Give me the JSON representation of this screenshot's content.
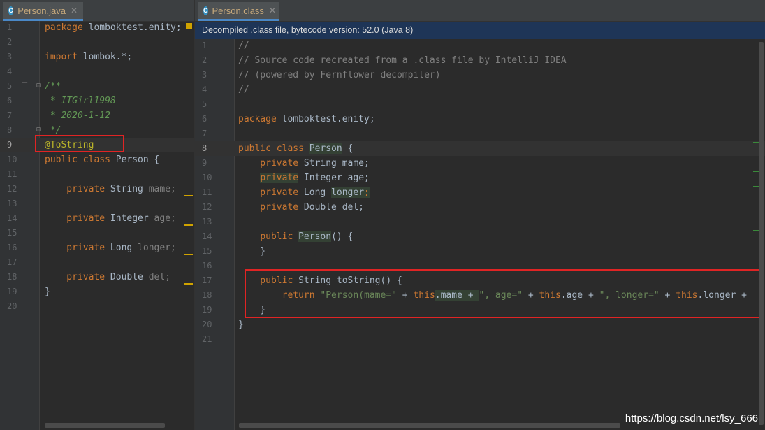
{
  "left_tab": {
    "label": "Person.java",
    "icon": "java-class-icon",
    "close": "✕"
  },
  "right_tab": {
    "label": "Person.class",
    "icon": "java-class-icon",
    "close": "✕"
  },
  "info_bar": "Decompiled .class file, bytecode version: 52.0 (Java 8)",
  "left_numbers": [
    "1",
    "2",
    "3",
    "4",
    "5",
    "6",
    "7",
    "8",
    "9",
    "10",
    "11",
    "12",
    "13",
    "14",
    "15",
    "16",
    "17",
    "18",
    "19",
    "20"
  ],
  "right_numbers": [
    "1",
    "2",
    "3",
    "4",
    "5",
    "6",
    "7",
    "8",
    "9",
    "10",
    "11",
    "12",
    "13",
    "14",
    "15",
    "16",
    "17",
    "18",
    "19",
    "20",
    "21"
  ],
  "left_code": {
    "l1_kw": "package",
    "l1_rest": " lomboktest.enity;",
    "l3_kw": "import",
    "l3_rest": " lombok.*;",
    "l5": "/**",
    "l6": " * ITGirl1998",
    "l7": " * 2020-1-12",
    "l8": " */",
    "l9": "@ToString",
    "l10_kw": "public class",
    "l10_rest": " Person {",
    "l12_kw": "    private",
    "l12_type": " String ",
    "l12_name": "mame;",
    "l14_kw": "    private",
    "l14_type": " Integer ",
    "l14_name": "age;",
    "l16_kw": "    private",
    "l16_type": " Long ",
    "l16_name": "longer;",
    "l18_kw": "    private",
    "l18_type": " Double ",
    "l18_name": "del;",
    "l19": "}"
  },
  "right_code": {
    "l1": "//",
    "l2": "// Source code recreated from a .class file by IntelliJ IDEA",
    "l3": "// (powered by Fernflower decompiler)",
    "l4": "//",
    "l6_kw": "package",
    "l6_rest": " lomboktest.enity;",
    "l8_kw": "public class",
    "l8_name": "Person",
    "l8_brace": " {",
    "l9_kw": "    private",
    "l9_rest": " String mame;",
    "l10_kw": "private",
    "l10_rest": " Integer age;",
    "l11_kw": "    private",
    "l11_type": " Long ",
    "l11_name": "longer",
    "l11_semi": ";",
    "l12_kw": "    private",
    "l12_rest": " Double del;",
    "l14_kw": "public",
    "l14_name": "Person",
    "l14_rest": "() {",
    "l15": "    }",
    "l17_kw": "    public",
    "l17_rest": " String toString() {",
    "l18_kw": "        return ",
    "l18_s1": "\"Person(mame=\"",
    "l18_p1": " + ",
    "l18_this1": "this",
    "l18_f1": ".mame + ",
    "l18_s2": "\", age=\"",
    "l18_p2": " + ",
    "l18_this2": "this",
    "l18_f2": ".age",
    "l18_p3": " + ",
    "l18_s3": "\", longer=\"",
    "l18_p4": " + ",
    "l18_this3": "this",
    "l18_f3": ".longer +",
    "l19": "    }",
    "l20": "}"
  },
  "watermark": "https://blog.csdn.net/lsy_666",
  "colors": {
    "background": "#2b2b2b",
    "keyword": "#cc7832",
    "string": "#6a8759",
    "comment": "#808080",
    "annotation": "#bbb529",
    "field": "#9876aa",
    "highlight_box": "#e02424",
    "info_bar": "#1e3557"
  }
}
